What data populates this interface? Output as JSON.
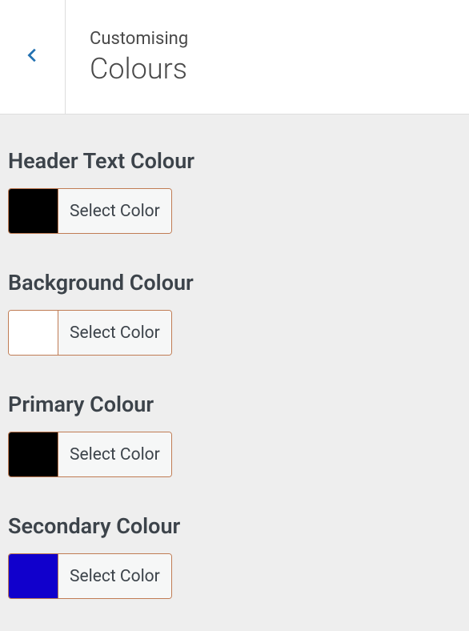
{
  "header": {
    "breadcrumb": "Customising",
    "title": "Colours"
  },
  "controls": [
    {
      "label": "Header Text Colour",
      "color": "#000000",
      "button": "Select Color"
    },
    {
      "label": "Background Colour",
      "color": "#ffffff",
      "button": "Select Color"
    },
    {
      "label": "Primary Colour",
      "color": "#000000",
      "button": "Select Color"
    },
    {
      "label": "Secondary Colour",
      "color": "#1100cc",
      "button": "Select Color"
    }
  ]
}
